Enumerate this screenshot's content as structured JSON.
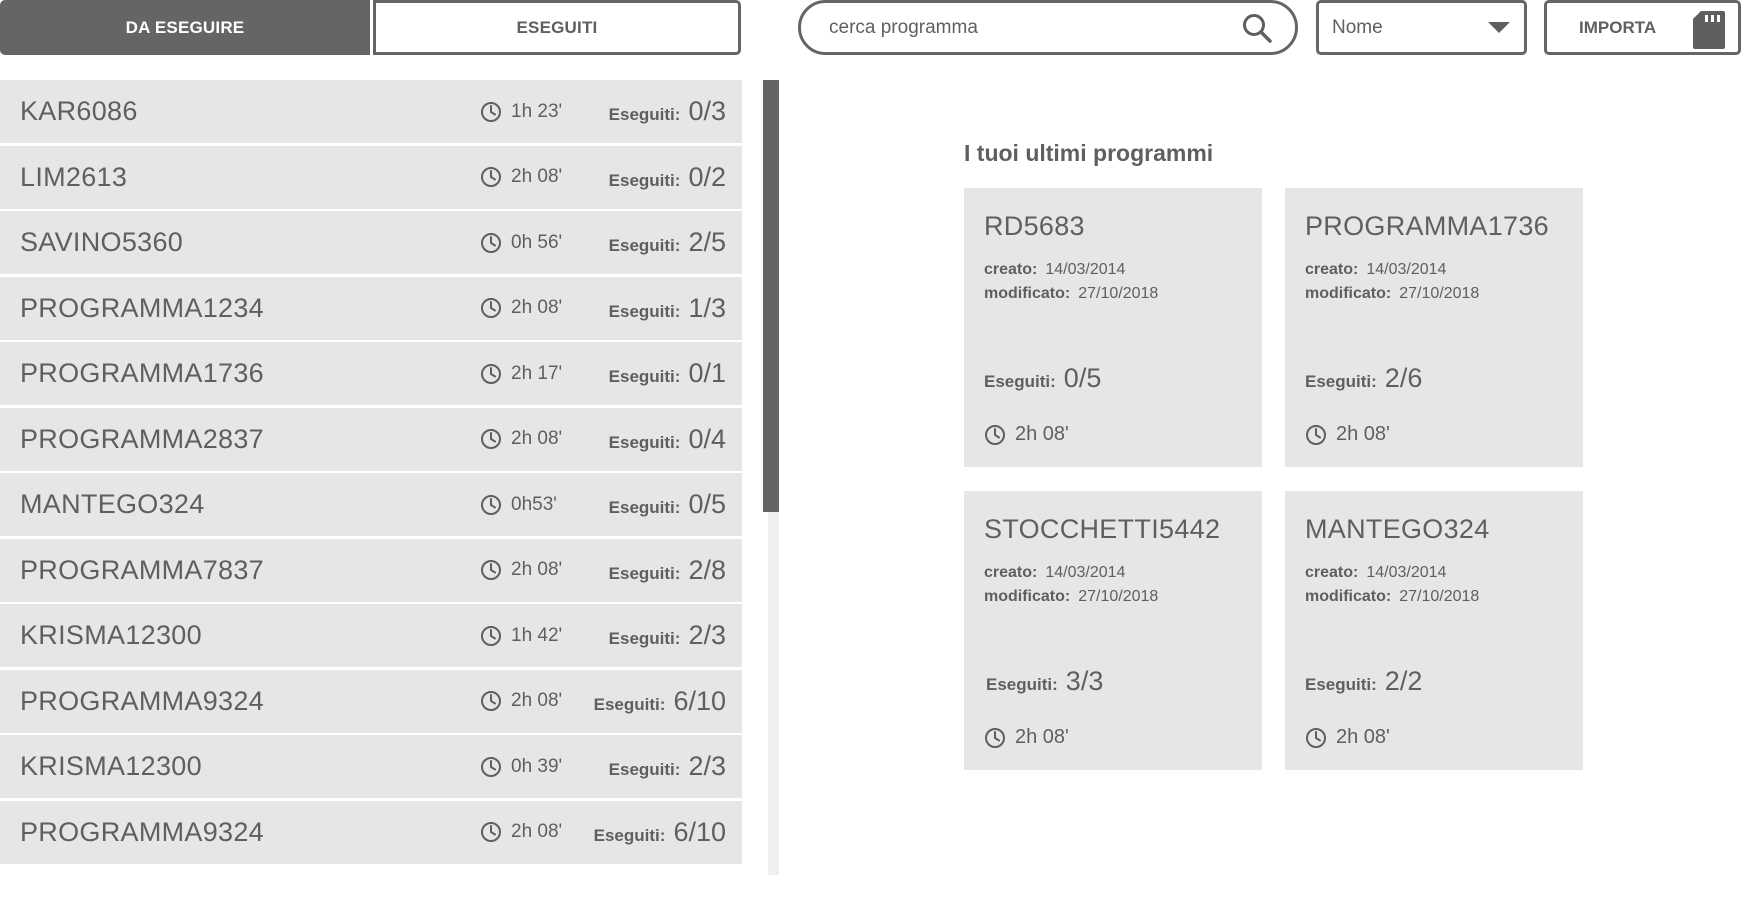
{
  "tabs": {
    "to_do": "DA ESEGUIRE",
    "done": "ESEGUITI"
  },
  "search": {
    "placeholder": "cerca programma"
  },
  "sort": {
    "selected": "Nome"
  },
  "import_label": "IMPORTA",
  "done_label": "Eseguiti:",
  "created_label": "creato:",
  "modified_label": "modificato:",
  "programs": [
    {
      "name": "KAR6086",
      "duration": "1h 23'",
      "done": "0/3"
    },
    {
      "name": "LIM2613",
      "duration": "2h 08'",
      "done": "0/2"
    },
    {
      "name": "SAVINO5360",
      "duration": "0h 56'",
      "done": "2/5"
    },
    {
      "name": "PROGRAMMA1234",
      "duration": "2h 08'",
      "done": "1/3"
    },
    {
      "name": "PROGRAMMA1736",
      "duration": "2h 17'",
      "done": "0/1"
    },
    {
      "name": "PROGRAMMA2837",
      "duration": "2h 08'",
      "done": "0/4"
    },
    {
      "name": "MANTEGO324",
      "duration": "0h53'",
      "done": "0/5"
    },
    {
      "name": "PROGRAMMA7837",
      "duration": "2h 08'",
      "done": "2/8"
    },
    {
      "name": "KRISMA12300",
      "duration": "1h 42'",
      "done": "2/3"
    },
    {
      "name": "PROGRAMMA9324",
      "duration": "2h 08'",
      "done": "6/10"
    },
    {
      "name": "KRISMA12300",
      "duration": "0h 39'",
      "done": "2/3"
    },
    {
      "name": "PROGRAMMA9324",
      "duration": "2h 08'",
      "done": "6/10"
    }
  ],
  "recent": {
    "title": "I tuoi ultimi programmi",
    "cards": [
      {
        "name": "RD5683",
        "created": "14/03/2014",
        "modified": "27/10/2018",
        "done": "0/5",
        "duration": "2h 08'"
      },
      {
        "name": "PROGRAMMA1736",
        "created": "14/03/2014",
        "modified": "27/10/2018",
        "done": "2/6",
        "duration": "2h 08'"
      },
      {
        "name": "STOCCHETTI5442",
        "created": "14/03/2014",
        "modified": "27/10/2018",
        "done": "3/3",
        "duration": "2h 08'"
      },
      {
        "name": "MANTEGO324",
        "created": "14/03/2014",
        "modified": "27/10/2018",
        "done": "2/2",
        "duration": "2h 08'"
      }
    ]
  }
}
